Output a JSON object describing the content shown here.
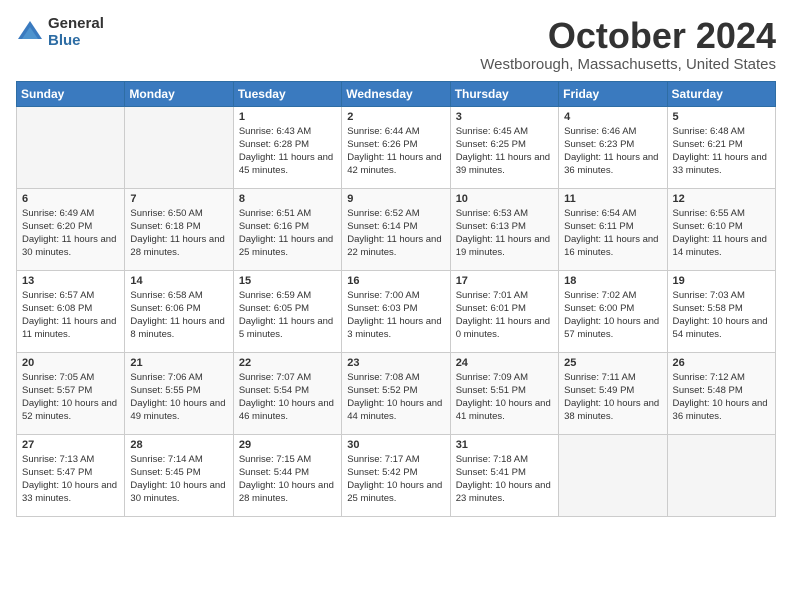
{
  "logo": {
    "general": "General",
    "blue": "Blue"
  },
  "title": "October 2024",
  "location": "Westborough, Massachusetts, United States",
  "weekdays": [
    "Sunday",
    "Monday",
    "Tuesday",
    "Wednesday",
    "Thursday",
    "Friday",
    "Saturday"
  ],
  "weeks": [
    [
      {
        "day": "",
        "info": ""
      },
      {
        "day": "",
        "info": ""
      },
      {
        "day": "1",
        "info": "Sunrise: 6:43 AM\nSunset: 6:28 PM\nDaylight: 11 hours and 45 minutes."
      },
      {
        "day": "2",
        "info": "Sunrise: 6:44 AM\nSunset: 6:26 PM\nDaylight: 11 hours and 42 minutes."
      },
      {
        "day": "3",
        "info": "Sunrise: 6:45 AM\nSunset: 6:25 PM\nDaylight: 11 hours and 39 minutes."
      },
      {
        "day": "4",
        "info": "Sunrise: 6:46 AM\nSunset: 6:23 PM\nDaylight: 11 hours and 36 minutes."
      },
      {
        "day": "5",
        "info": "Sunrise: 6:48 AM\nSunset: 6:21 PM\nDaylight: 11 hours and 33 minutes."
      }
    ],
    [
      {
        "day": "6",
        "info": "Sunrise: 6:49 AM\nSunset: 6:20 PM\nDaylight: 11 hours and 30 minutes."
      },
      {
        "day": "7",
        "info": "Sunrise: 6:50 AM\nSunset: 6:18 PM\nDaylight: 11 hours and 28 minutes."
      },
      {
        "day": "8",
        "info": "Sunrise: 6:51 AM\nSunset: 6:16 PM\nDaylight: 11 hours and 25 minutes."
      },
      {
        "day": "9",
        "info": "Sunrise: 6:52 AM\nSunset: 6:14 PM\nDaylight: 11 hours and 22 minutes."
      },
      {
        "day": "10",
        "info": "Sunrise: 6:53 AM\nSunset: 6:13 PM\nDaylight: 11 hours and 19 minutes."
      },
      {
        "day": "11",
        "info": "Sunrise: 6:54 AM\nSunset: 6:11 PM\nDaylight: 11 hours and 16 minutes."
      },
      {
        "day": "12",
        "info": "Sunrise: 6:55 AM\nSunset: 6:10 PM\nDaylight: 11 hours and 14 minutes."
      }
    ],
    [
      {
        "day": "13",
        "info": "Sunrise: 6:57 AM\nSunset: 6:08 PM\nDaylight: 11 hours and 11 minutes."
      },
      {
        "day": "14",
        "info": "Sunrise: 6:58 AM\nSunset: 6:06 PM\nDaylight: 11 hours and 8 minutes."
      },
      {
        "day": "15",
        "info": "Sunrise: 6:59 AM\nSunset: 6:05 PM\nDaylight: 11 hours and 5 minutes."
      },
      {
        "day": "16",
        "info": "Sunrise: 7:00 AM\nSunset: 6:03 PM\nDaylight: 11 hours and 3 minutes."
      },
      {
        "day": "17",
        "info": "Sunrise: 7:01 AM\nSunset: 6:01 PM\nDaylight: 11 hours and 0 minutes."
      },
      {
        "day": "18",
        "info": "Sunrise: 7:02 AM\nSunset: 6:00 PM\nDaylight: 10 hours and 57 minutes."
      },
      {
        "day": "19",
        "info": "Sunrise: 7:03 AM\nSunset: 5:58 PM\nDaylight: 10 hours and 54 minutes."
      }
    ],
    [
      {
        "day": "20",
        "info": "Sunrise: 7:05 AM\nSunset: 5:57 PM\nDaylight: 10 hours and 52 minutes."
      },
      {
        "day": "21",
        "info": "Sunrise: 7:06 AM\nSunset: 5:55 PM\nDaylight: 10 hours and 49 minutes."
      },
      {
        "day": "22",
        "info": "Sunrise: 7:07 AM\nSunset: 5:54 PM\nDaylight: 10 hours and 46 minutes."
      },
      {
        "day": "23",
        "info": "Sunrise: 7:08 AM\nSunset: 5:52 PM\nDaylight: 10 hours and 44 minutes."
      },
      {
        "day": "24",
        "info": "Sunrise: 7:09 AM\nSunset: 5:51 PM\nDaylight: 10 hours and 41 minutes."
      },
      {
        "day": "25",
        "info": "Sunrise: 7:11 AM\nSunset: 5:49 PM\nDaylight: 10 hours and 38 minutes."
      },
      {
        "day": "26",
        "info": "Sunrise: 7:12 AM\nSunset: 5:48 PM\nDaylight: 10 hours and 36 minutes."
      }
    ],
    [
      {
        "day": "27",
        "info": "Sunrise: 7:13 AM\nSunset: 5:47 PM\nDaylight: 10 hours and 33 minutes."
      },
      {
        "day": "28",
        "info": "Sunrise: 7:14 AM\nSunset: 5:45 PM\nDaylight: 10 hours and 30 minutes."
      },
      {
        "day": "29",
        "info": "Sunrise: 7:15 AM\nSunset: 5:44 PM\nDaylight: 10 hours and 28 minutes."
      },
      {
        "day": "30",
        "info": "Sunrise: 7:17 AM\nSunset: 5:42 PM\nDaylight: 10 hours and 25 minutes."
      },
      {
        "day": "31",
        "info": "Sunrise: 7:18 AM\nSunset: 5:41 PM\nDaylight: 10 hours and 23 minutes."
      },
      {
        "day": "",
        "info": ""
      },
      {
        "day": "",
        "info": ""
      }
    ]
  ]
}
